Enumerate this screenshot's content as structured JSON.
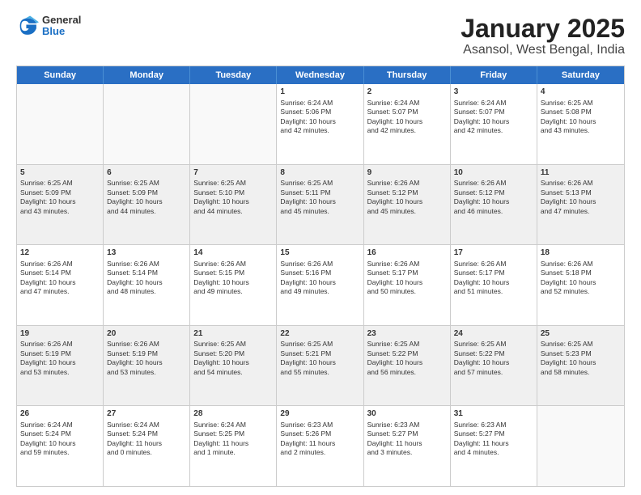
{
  "header": {
    "logo": {
      "general": "General",
      "blue": "Blue"
    },
    "title": "January 2025",
    "subtitle": "Asansol, West Bengal, India"
  },
  "weekdays": [
    "Sunday",
    "Monday",
    "Tuesday",
    "Wednesday",
    "Thursday",
    "Friday",
    "Saturday"
  ],
  "rows": [
    [
      {
        "day": "",
        "info": "",
        "empty": true
      },
      {
        "day": "",
        "info": "",
        "empty": true
      },
      {
        "day": "",
        "info": "",
        "empty": true
      },
      {
        "day": "1",
        "info": "Sunrise: 6:24 AM\nSunset: 5:06 PM\nDaylight: 10 hours\nand 42 minutes."
      },
      {
        "day": "2",
        "info": "Sunrise: 6:24 AM\nSunset: 5:07 PM\nDaylight: 10 hours\nand 42 minutes."
      },
      {
        "day": "3",
        "info": "Sunrise: 6:24 AM\nSunset: 5:07 PM\nDaylight: 10 hours\nand 42 minutes."
      },
      {
        "day": "4",
        "info": "Sunrise: 6:25 AM\nSunset: 5:08 PM\nDaylight: 10 hours\nand 43 minutes."
      }
    ],
    [
      {
        "day": "5",
        "info": "Sunrise: 6:25 AM\nSunset: 5:09 PM\nDaylight: 10 hours\nand 43 minutes."
      },
      {
        "day": "6",
        "info": "Sunrise: 6:25 AM\nSunset: 5:09 PM\nDaylight: 10 hours\nand 44 minutes."
      },
      {
        "day": "7",
        "info": "Sunrise: 6:25 AM\nSunset: 5:10 PM\nDaylight: 10 hours\nand 44 minutes."
      },
      {
        "day": "8",
        "info": "Sunrise: 6:25 AM\nSunset: 5:11 PM\nDaylight: 10 hours\nand 45 minutes."
      },
      {
        "day": "9",
        "info": "Sunrise: 6:26 AM\nSunset: 5:12 PM\nDaylight: 10 hours\nand 45 minutes."
      },
      {
        "day": "10",
        "info": "Sunrise: 6:26 AM\nSunset: 5:12 PM\nDaylight: 10 hours\nand 46 minutes."
      },
      {
        "day": "11",
        "info": "Sunrise: 6:26 AM\nSunset: 5:13 PM\nDaylight: 10 hours\nand 47 minutes."
      }
    ],
    [
      {
        "day": "12",
        "info": "Sunrise: 6:26 AM\nSunset: 5:14 PM\nDaylight: 10 hours\nand 47 minutes."
      },
      {
        "day": "13",
        "info": "Sunrise: 6:26 AM\nSunset: 5:14 PM\nDaylight: 10 hours\nand 48 minutes."
      },
      {
        "day": "14",
        "info": "Sunrise: 6:26 AM\nSunset: 5:15 PM\nDaylight: 10 hours\nand 49 minutes."
      },
      {
        "day": "15",
        "info": "Sunrise: 6:26 AM\nSunset: 5:16 PM\nDaylight: 10 hours\nand 49 minutes."
      },
      {
        "day": "16",
        "info": "Sunrise: 6:26 AM\nSunset: 5:17 PM\nDaylight: 10 hours\nand 50 minutes."
      },
      {
        "day": "17",
        "info": "Sunrise: 6:26 AM\nSunset: 5:17 PM\nDaylight: 10 hours\nand 51 minutes."
      },
      {
        "day": "18",
        "info": "Sunrise: 6:26 AM\nSunset: 5:18 PM\nDaylight: 10 hours\nand 52 minutes."
      }
    ],
    [
      {
        "day": "19",
        "info": "Sunrise: 6:26 AM\nSunset: 5:19 PM\nDaylight: 10 hours\nand 53 minutes."
      },
      {
        "day": "20",
        "info": "Sunrise: 6:26 AM\nSunset: 5:19 PM\nDaylight: 10 hours\nand 53 minutes."
      },
      {
        "day": "21",
        "info": "Sunrise: 6:25 AM\nSunset: 5:20 PM\nDaylight: 10 hours\nand 54 minutes."
      },
      {
        "day": "22",
        "info": "Sunrise: 6:25 AM\nSunset: 5:21 PM\nDaylight: 10 hours\nand 55 minutes."
      },
      {
        "day": "23",
        "info": "Sunrise: 6:25 AM\nSunset: 5:22 PM\nDaylight: 10 hours\nand 56 minutes."
      },
      {
        "day": "24",
        "info": "Sunrise: 6:25 AM\nSunset: 5:22 PM\nDaylight: 10 hours\nand 57 minutes."
      },
      {
        "day": "25",
        "info": "Sunrise: 6:25 AM\nSunset: 5:23 PM\nDaylight: 10 hours\nand 58 minutes."
      }
    ],
    [
      {
        "day": "26",
        "info": "Sunrise: 6:24 AM\nSunset: 5:24 PM\nDaylight: 10 hours\nand 59 minutes."
      },
      {
        "day": "27",
        "info": "Sunrise: 6:24 AM\nSunset: 5:24 PM\nDaylight: 11 hours\nand 0 minutes."
      },
      {
        "day": "28",
        "info": "Sunrise: 6:24 AM\nSunset: 5:25 PM\nDaylight: 11 hours\nand 1 minute."
      },
      {
        "day": "29",
        "info": "Sunrise: 6:23 AM\nSunset: 5:26 PM\nDaylight: 11 hours\nand 2 minutes."
      },
      {
        "day": "30",
        "info": "Sunrise: 6:23 AM\nSunset: 5:27 PM\nDaylight: 11 hours\nand 3 minutes."
      },
      {
        "day": "31",
        "info": "Sunrise: 6:23 AM\nSunset: 5:27 PM\nDaylight: 11 hours\nand 4 minutes."
      },
      {
        "day": "",
        "info": "",
        "empty": true
      }
    ]
  ]
}
